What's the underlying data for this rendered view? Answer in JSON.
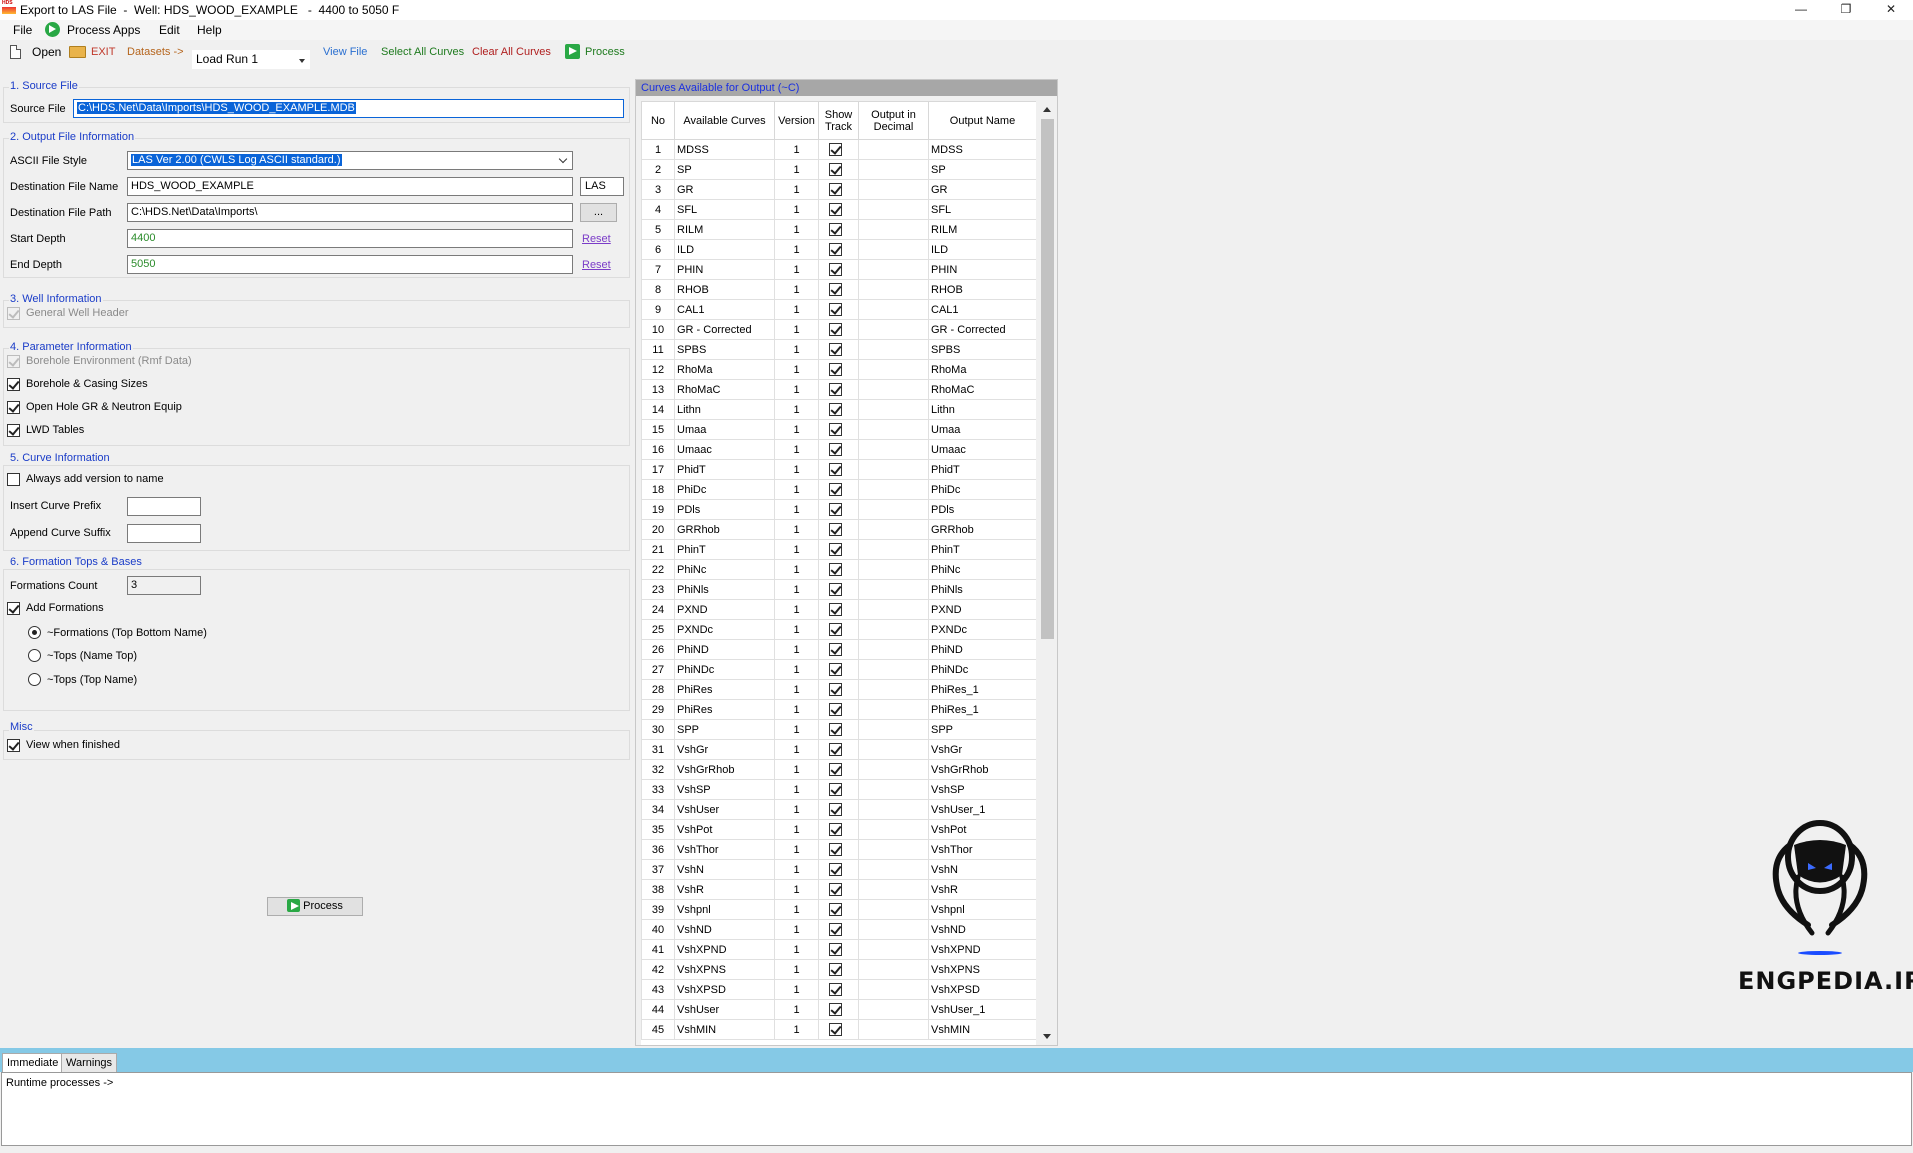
{
  "window": {
    "title": "Export to LAS File  -  Well: HDS_WOOD_EXAMPLE   -  4400 to 5050 F",
    "icon_text": "HDS",
    "minimize": "—",
    "restore": "❐",
    "close": "✕"
  },
  "menu": {
    "file": "File",
    "process_apps": "Process Apps",
    "edit": "Edit",
    "help": "Help"
  },
  "toolbar": {
    "open": "Open",
    "exit": "EXIT",
    "datasets": "Datasets ->",
    "load_run": "Load Run 1",
    "view_file": "View File",
    "select_all": "Select All Curves",
    "clear_all": "Clear All Curves",
    "process": "Process"
  },
  "source": {
    "section": "1. Source File",
    "label": "Source File",
    "value": "C:\\HDS.Net\\Data\\Imports\\HDS_WOOD_EXAMPLE.MDB"
  },
  "output": {
    "section": "2. Output File Information",
    "style_label": "ASCII File Style",
    "style_value": "LAS Ver 2.00 (CWLS Log ASCII standard.)",
    "dest_name_label": "Destination File Name",
    "dest_name_value": "HDS_WOOD_EXAMPLE",
    "ext": "LAS",
    "dest_path_label": "Destination File Path",
    "dest_path_value": "C:\\HDS.Net\\Data\\Imports\\",
    "browse": "...",
    "start_label": "Start Depth",
    "start_value": "4400",
    "end_label": "End Depth",
    "end_value": "5050",
    "reset": "Reset"
  },
  "well": {
    "section": "3. Well Information",
    "general_header": "General Well Header"
  },
  "params": {
    "section": "4. Parameter Information",
    "borehole_env": "Borehole Environment (Rmf Data)",
    "borehole_casing": "Borehole & Casing Sizes",
    "open_hole": "Open Hole GR & Neutron Equip",
    "lwd": "LWD Tables"
  },
  "curve_info": {
    "section": "5. Curve Information",
    "always_add": "Always add version to name",
    "prefix_label": "Insert Curve Prefix",
    "suffix_label": "Append Curve Suffix"
  },
  "formations": {
    "section": "6. Formation Tops & Bases",
    "count_label": "Formations Count",
    "count_value": "3",
    "add": "Add Formations",
    "opt1": "~Formations (Top Bottom Name)",
    "opt2": "~Tops (Name Top)",
    "opt3": "~Tops (Top Name)"
  },
  "misc": {
    "section": "Misc",
    "view_finished": "View when finished"
  },
  "process_button": "Process",
  "curves": {
    "header": "Curves Available for Output (~C)",
    "columns": [
      "No",
      "Available Curves",
      "Version",
      "Show Track",
      "Output in Decimal",
      "Output Name"
    ],
    "rows": [
      [
        "1",
        "MDSS",
        "1",
        "MDSS"
      ],
      [
        "2",
        "SP",
        "1",
        "SP"
      ],
      [
        "3",
        "GR",
        "1",
        "GR"
      ],
      [
        "4",
        "SFL",
        "1",
        "SFL"
      ],
      [
        "5",
        "RILM",
        "1",
        "RILM"
      ],
      [
        "6",
        "ILD",
        "1",
        "ILD"
      ],
      [
        "7",
        "PHIN",
        "1",
        "PHIN"
      ],
      [
        "8",
        "RHOB",
        "1",
        "RHOB"
      ],
      [
        "9",
        "CAL1",
        "1",
        "CAL1"
      ],
      [
        "10",
        "GR - Corrected",
        "1",
        "GR - Corrected"
      ],
      [
        "11",
        "SPBS",
        "1",
        "SPBS"
      ],
      [
        "12",
        "RhoMa",
        "1",
        "RhoMa"
      ],
      [
        "13",
        "RhoMaC",
        "1",
        "RhoMaC"
      ],
      [
        "14",
        "Lithn",
        "1",
        "Lithn"
      ],
      [
        "15",
        "Umaa",
        "1",
        "Umaa"
      ],
      [
        "16",
        "Umaac",
        "1",
        "Umaac"
      ],
      [
        "17",
        "PhidT",
        "1",
        "PhidT"
      ],
      [
        "18",
        "PhiDc",
        "1",
        "PhiDc"
      ],
      [
        "19",
        "PDls",
        "1",
        "PDls"
      ],
      [
        "20",
        "GRRhob",
        "1",
        "GRRhob"
      ],
      [
        "21",
        "PhinT",
        "1",
        "PhinT"
      ],
      [
        "22",
        "PhiNc",
        "1",
        "PhiNc"
      ],
      [
        "23",
        "PhiNls",
        "1",
        "PhiNls"
      ],
      [
        "24",
        "PXND",
        "1",
        "PXND"
      ],
      [
        "25",
        "PXNDc",
        "1",
        "PXNDc"
      ],
      [
        "26",
        "PhiND",
        "1",
        "PhiND"
      ],
      [
        "27",
        "PhiNDc",
        "1",
        "PhiNDc"
      ],
      [
        "28",
        "PhiRes",
        "1",
        "PhiRes_1"
      ],
      [
        "29",
        "PhiRes",
        "1",
        "PhiRes_1"
      ],
      [
        "30",
        "SPP",
        "1",
        "SPP"
      ],
      [
        "31",
        "VshGr",
        "1",
        "VshGr"
      ],
      [
        "32",
        "VshGrRhob",
        "1",
        "VshGrRhob"
      ],
      [
        "33",
        "VshSP",
        "1",
        "VshSP"
      ],
      [
        "34",
        "VshUser",
        "1",
        "VshUser_1"
      ],
      [
        "35",
        "VshPot",
        "1",
        "VshPot"
      ],
      [
        "36",
        "VshThor",
        "1",
        "VshThor"
      ],
      [
        "37",
        "VshN",
        "1",
        "VshN"
      ],
      [
        "38",
        "VshR",
        "1",
        "VshR"
      ],
      [
        "39",
        "Vshpnl",
        "1",
        "Vshpnl"
      ],
      [
        "40",
        "VshND",
        "1",
        "VshND"
      ],
      [
        "41",
        "VshXPND",
        "1",
        "VshXPND"
      ],
      [
        "42",
        "VshXPNS",
        "1",
        "VshXPNS"
      ],
      [
        "43",
        "VshXPSD",
        "1",
        "VshXPSD"
      ],
      [
        "44",
        "VshUser",
        "1",
        "VshUser_1"
      ],
      [
        "45",
        "VshMIN",
        "1",
        "VshMIN"
      ]
    ]
  },
  "watermark": {
    "text": "ENGPEDIA.IR"
  },
  "bottom": {
    "tab_immediate": "Immediate",
    "tab_warnings": "Warnings",
    "output_text": "Runtime processes ->"
  }
}
